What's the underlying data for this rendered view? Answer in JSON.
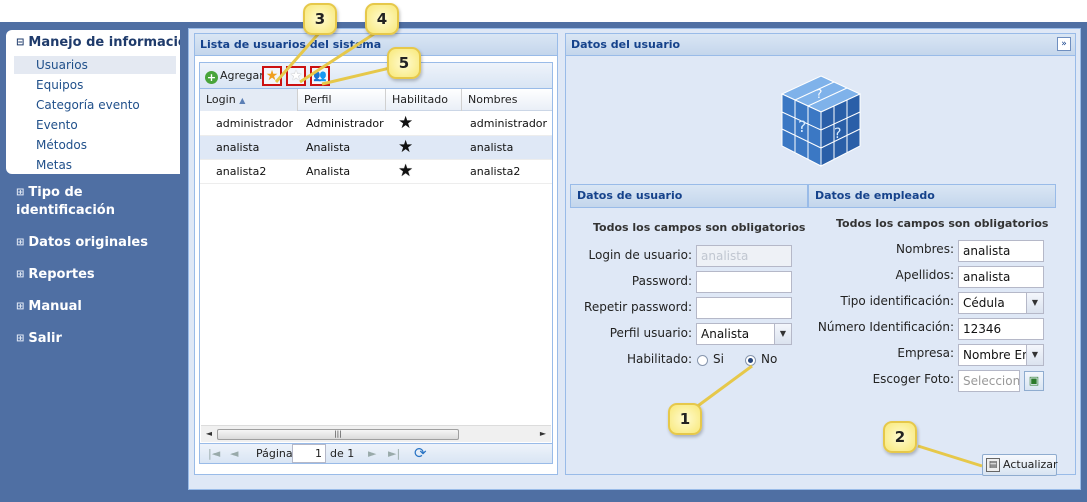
{
  "nav": {
    "open_group": "Manejo de información",
    "sub_items": [
      "Usuarios",
      "Equipos",
      "Categoría evento",
      "Evento",
      "Métodos",
      "Metas"
    ],
    "groups": [
      "Tipo de identificación",
      "Datos originales",
      "Reportes",
      "Manual",
      "Salir"
    ]
  },
  "grid": {
    "title": "Lista de usuarios del sistema",
    "toolbar": {
      "add_label": "Agregar"
    },
    "columns": [
      "Login",
      "Perfil",
      "Habilitado",
      "Nombres"
    ],
    "sort_indicator": "▲",
    "rows": [
      {
        "login": "administrador",
        "perfil": "Administrador",
        "habilitado": true,
        "nombres": "administrador"
      },
      {
        "login": "analista",
        "perfil": "Analista",
        "habilitado": true,
        "nombres": "analista"
      },
      {
        "login": "analista2",
        "perfil": "Analista",
        "habilitado": false,
        "nombres": "analista2"
      }
    ],
    "pager": {
      "page_label": "Página",
      "page_value": "1",
      "of_label": "de 1"
    }
  },
  "detail": {
    "title": "Datos del usuario",
    "user_section": {
      "title": "Datos de usuario",
      "required_note": "Todos los campos son obligatorios",
      "login_label": "Login de usuario:",
      "login_value": "analista",
      "password_label": "Password:",
      "repeat_label": "Repetir password:",
      "profile_label": "Perfil usuario:",
      "profile_value": "Analista",
      "enabled_label": "Habilitado:",
      "yes_label": "Si",
      "no_label": "No"
    },
    "employee_section": {
      "title": "Datos de empleado",
      "required_note": "Todos los campos son obligatorios",
      "names_label": "Nombres:",
      "names_value": "analista",
      "surnames_label": "Apellidos:",
      "surnames_value": "analista",
      "idtype_label": "Tipo identificación:",
      "idtype_value": "Cédula",
      "idnum_label": "Número Identificación:",
      "idnum_value": "12346",
      "company_label": "Empresa:",
      "company_value": "Nombre En",
      "photo_label": "Escoger Foto:",
      "photo_placeholder": "Seleccione"
    },
    "update_label": "Actualizar"
  },
  "callouts": [
    "1",
    "2",
    "3",
    "4",
    "5"
  ],
  "colors": {
    "nav_bg": "#4f6fa3",
    "header_text": "#15428b",
    "panel_border": "#99bbe8",
    "selected_row": "#dfe8f6",
    "callout_fill": "#f8e878"
  }
}
